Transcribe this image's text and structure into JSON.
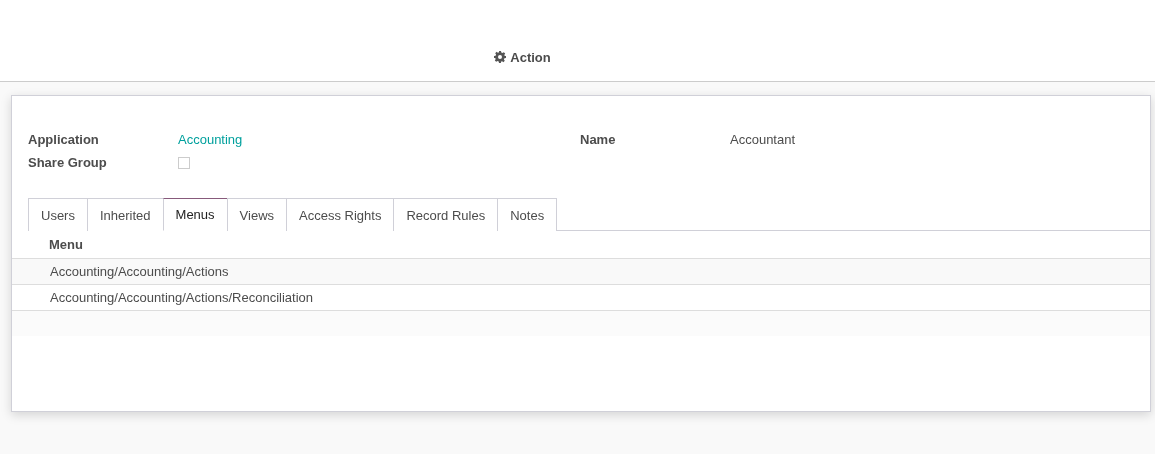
{
  "toolbar": {
    "action_label": "Action"
  },
  "form": {
    "fields": [
      {
        "label": "Application",
        "value": "Accounting",
        "kind": "link"
      },
      {
        "label": "Name",
        "value": "Accountant",
        "kind": "text"
      },
      {
        "label": "Share Group",
        "kind": "checkbox",
        "checked": false
      }
    ]
  },
  "tabs": [
    {
      "label": "Users",
      "selected": false
    },
    {
      "label": "Inherited",
      "selected": false
    },
    {
      "label": "Menus",
      "selected": true
    },
    {
      "label": "Views",
      "selected": false
    },
    {
      "label": "Access Rights",
      "selected": false
    },
    {
      "label": "Record Rules",
      "selected": false
    },
    {
      "label": "Notes",
      "selected": false
    }
  ],
  "table": {
    "columns": [
      "Menu"
    ],
    "rows": [
      [
        "Accounting/Accounting/Actions"
      ],
      [
        "Accounting/Accounting/Actions/Reconciliation"
      ]
    ]
  }
}
